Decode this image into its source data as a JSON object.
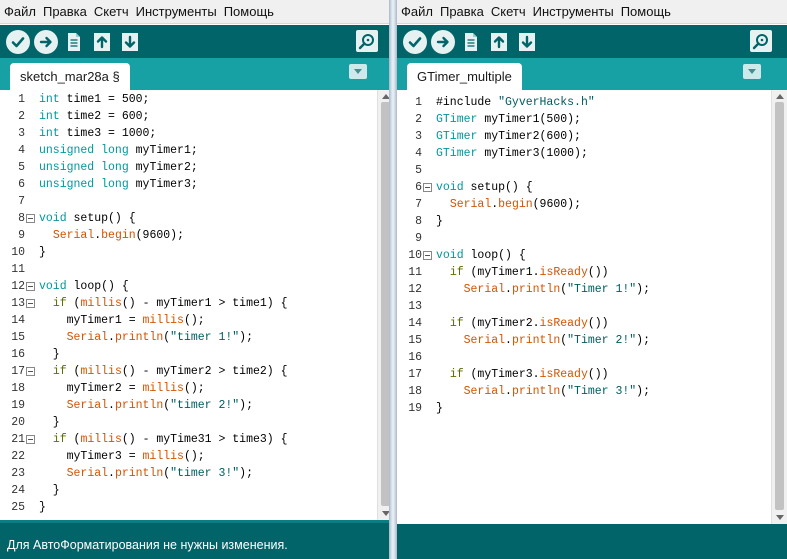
{
  "left": {
    "menu": [
      "Файл",
      "Правка",
      "Скетч",
      "Инструменты",
      "Помощь"
    ],
    "tab_label": "sketch_mar28a §",
    "status_message": "Для АвтоФорматирования не нужны изменения.",
    "lines": [
      {
        "n": "1",
        "fold": false,
        "text": "int time1 = 500;"
      },
      {
        "n": "2",
        "fold": false,
        "text": "int time2 = 600;"
      },
      {
        "n": "3",
        "fold": false,
        "text": "int time3 = 1000;"
      },
      {
        "n": "4",
        "fold": false,
        "text": "unsigned long myTimer1;"
      },
      {
        "n": "5",
        "fold": false,
        "text": "unsigned long myTimer2;"
      },
      {
        "n": "6",
        "fold": false,
        "text": "unsigned long myTimer3;"
      },
      {
        "n": "7",
        "fold": false,
        "text": ""
      },
      {
        "n": "8",
        "fold": true,
        "text": "void setup() {"
      },
      {
        "n": "9",
        "fold": false,
        "text": "  Serial.begin(9600);"
      },
      {
        "n": "10",
        "fold": false,
        "text": "}"
      },
      {
        "n": "11",
        "fold": false,
        "text": ""
      },
      {
        "n": "12",
        "fold": true,
        "text": "void loop() {"
      },
      {
        "n": "13",
        "fold": true,
        "text": "  if (millis() - myTimer1 > time1) {"
      },
      {
        "n": "14",
        "fold": false,
        "text": "    myTimer1 = millis();"
      },
      {
        "n": "15",
        "fold": false,
        "text": "    Serial.println(\"timer 1!\");"
      },
      {
        "n": "16",
        "fold": false,
        "text": "  }"
      },
      {
        "n": "17",
        "fold": true,
        "text": "  if (millis() - myTimer2 > time2) {"
      },
      {
        "n": "18",
        "fold": false,
        "text": "    myTimer2 = millis();"
      },
      {
        "n": "19",
        "fold": false,
        "text": "    Serial.println(\"timer 2!\");"
      },
      {
        "n": "20",
        "fold": false,
        "text": "  }"
      },
      {
        "n": "21",
        "fold": true,
        "text": "  if (millis() - myTime31 > time3) {"
      },
      {
        "n": "22",
        "fold": false,
        "text": "    myTimer3 = millis();"
      },
      {
        "n": "23",
        "fold": false,
        "text": "    Serial.println(\"timer 3!\");"
      },
      {
        "n": "24",
        "fold": false,
        "text": "  }"
      },
      {
        "n": "25",
        "fold": false,
        "text": "}"
      }
    ]
  },
  "right": {
    "menu": [
      "Файл",
      "Правка",
      "Скетч",
      "Инструменты",
      "Помощь"
    ],
    "tab_label": "GTimer_multiple",
    "lines": [
      {
        "n": "1",
        "fold": false,
        "text": "#include \"GyverHacks.h\""
      },
      {
        "n": "2",
        "fold": false,
        "text": "GTimer myTimer1(500);"
      },
      {
        "n": "3",
        "fold": false,
        "text": "GTimer myTimer2(600);"
      },
      {
        "n": "4",
        "fold": false,
        "text": "GTimer myTimer3(1000);"
      },
      {
        "n": "5",
        "fold": false,
        "text": ""
      },
      {
        "n": "6",
        "fold": true,
        "text": "void setup() {"
      },
      {
        "n": "7",
        "fold": false,
        "text": "  Serial.begin(9600);"
      },
      {
        "n": "8",
        "fold": false,
        "text": "}"
      },
      {
        "n": "9",
        "fold": false,
        "text": ""
      },
      {
        "n": "10",
        "fold": true,
        "text": "void loop() {"
      },
      {
        "n": "11",
        "fold": false,
        "text": "  if (myTimer1.isReady())"
      },
      {
        "n": "12",
        "fold": false,
        "text": "    Serial.println(\"Timer 1!\");"
      },
      {
        "n": "13",
        "fold": false,
        "text": ""
      },
      {
        "n": "14",
        "fold": false,
        "text": "  if (myTimer2.isReady())"
      },
      {
        "n": "15",
        "fold": false,
        "text": "    Serial.println(\"Timer 2!\");"
      },
      {
        "n": "16",
        "fold": false,
        "text": ""
      },
      {
        "n": "17",
        "fold": false,
        "text": "  if (myTimer3.isReady())"
      },
      {
        "n": "18",
        "fold": false,
        "text": "    Serial.println(\"Timer 3!\");"
      },
      {
        "n": "19",
        "fold": false,
        "text": "}"
      }
    ]
  },
  "icons": {
    "verify": "check-icon",
    "upload": "arrow-right-icon",
    "new": "document-icon",
    "open": "arrow-up-icon",
    "save": "arrow-down-icon",
    "serial_monitor": "magnifier-icon",
    "tab_menu": "chevron-down-icon",
    "fold": "fold-minus-icon"
  },
  "colors": {
    "toolbar": "#006468",
    "tabbar": "#17a1a5",
    "keyword_type": "#00979c",
    "keyword_control": "#5e6d03",
    "function": "#d35400",
    "string": "#005c5f"
  }
}
